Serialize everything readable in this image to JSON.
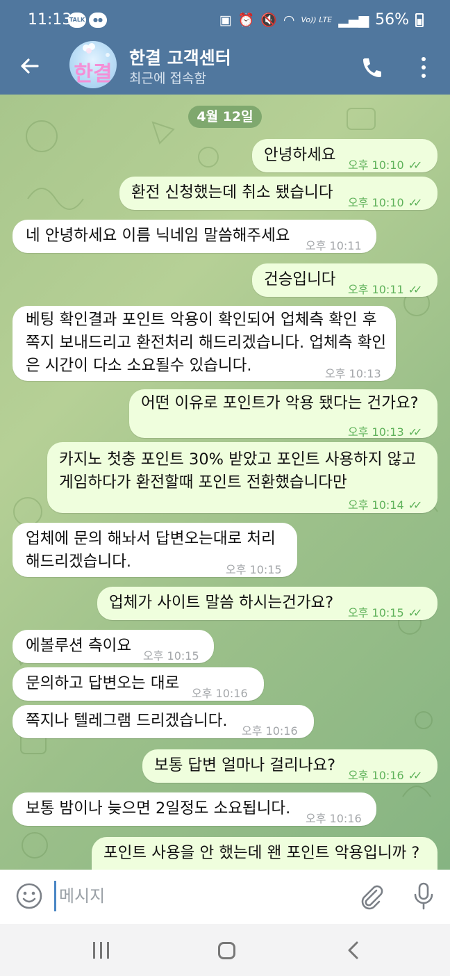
{
  "status_bar": {
    "time": "11:13",
    "left_icons": [
      "kakaotalk-icon",
      "message-icon"
    ],
    "right_icons": [
      "screenshot-icon",
      "alarm-icon",
      "mute-icon",
      "wifi-icon",
      "volte-icon",
      "signal-icon"
    ],
    "volte_label": "Vo)) LTE",
    "battery": "56%"
  },
  "header": {
    "back_icon": "arrow-left-icon",
    "avatar_text": "한결",
    "title": "한결 고객센터",
    "subtitle": "최근에 접속함",
    "call_icon": "phone-icon",
    "menu_icon": "more-vertical-icon"
  },
  "chat": {
    "date_chip": "4월 12일",
    "messages": [
      {
        "dir": "out",
        "text": "안녕하세요",
        "time": "오후 10:10",
        "status": "read"
      },
      {
        "dir": "out",
        "text": "환전 신청했는데 취소 됐습니다",
        "time": "오후 10:10",
        "status": "read"
      },
      {
        "dir": "in",
        "text": "네 안녕하세요 이름 닉네임 말씀해주세요",
        "time": "오후 10:11"
      },
      {
        "dir": "out",
        "text": "건승입니다",
        "time": "오후 10:11",
        "status": "read"
      },
      {
        "dir": "in",
        "text": "베팅 확인결과 포인트 악용이 확인되어 업체측 확인 후 쪽지 보내드리고 환전처리 해드리겠습니다. 업체측 확인은 시간이 다소 소요될수 있습니다.",
        "time": "오후 10:13"
      },
      {
        "dir": "out",
        "text": "어떤 이유로 포인트가 악용 됐다는 건가요?",
        "time": "오후 10:13",
        "status": "read"
      },
      {
        "dir": "out",
        "text": "카지노 첫충 포인트 30% 받았고 포인트 사용하지 않고 게임하다가 환전할때 포인트 전환했습니다만",
        "time": "오후 10:14",
        "status": "read"
      },
      {
        "dir": "in",
        "text": "업체에 문의 해놔서 답변오는대로 처리 해드리겠습니다.",
        "time": "오후 10:15"
      },
      {
        "dir": "out",
        "text": "업체가 사이트 말씀 하시는건가요?",
        "time": "오후 10:15",
        "status": "read"
      },
      {
        "dir": "in",
        "text": "에볼루션 측이요",
        "time": "오후 10:15"
      },
      {
        "dir": "in",
        "text": "문의하고 답변오는 대로",
        "time": "오후 10:16"
      },
      {
        "dir": "in",
        "text": "쪽지나 텔레그램 드리겠습니다.",
        "time": "오후 10:16"
      },
      {
        "dir": "out",
        "text": "보통 답변 얼마나 걸리나요?",
        "time": "오후 10:16",
        "status": "read"
      },
      {
        "dir": "in",
        "text": "보통 밤이나 늦으면 2일정도 소요됩니다.",
        "time": "오후 10:16"
      },
      {
        "dir": "out",
        "text": "포인트 사용을 안 했는데 왠 포인트 악용입니까 ?",
        "time": "",
        "status": ""
      }
    ]
  },
  "composer": {
    "emoji_icon": "emoji-icon",
    "placeholder": "메시지",
    "attach_icon": "paperclip-icon",
    "mic_icon": "microphone-icon"
  },
  "navbar": {
    "icons": [
      "recent-apps-icon",
      "home-icon",
      "back-icon"
    ]
  },
  "colors": {
    "header": "#50779e",
    "incoming_bubble": "#ffffff",
    "outgoing_bubble": "#effedd",
    "read_ticks": "#5fb25a",
    "chat_background": "#a8c68c"
  }
}
